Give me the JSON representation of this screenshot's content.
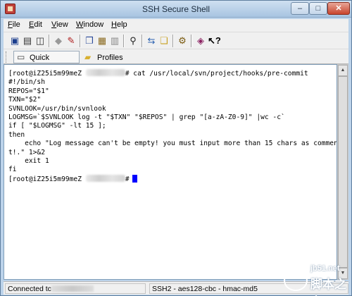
{
  "window": {
    "title": "SSH Secure Shell"
  },
  "title_buttons": {
    "minimize": "–",
    "maximize": "□",
    "close": "✕"
  },
  "menu": [
    {
      "label": "File",
      "u": "F",
      "rest": "ile"
    },
    {
      "label": "Edit",
      "u": "E",
      "rest": "dit"
    },
    {
      "label": "View",
      "u": "V",
      "rest": "iew"
    },
    {
      "label": "Window",
      "u": "W",
      "rest": "indow"
    },
    {
      "label": "Help",
      "u": "H",
      "rest": "elp"
    }
  ],
  "toolbar_icons": [
    "save-icon",
    "print-icon",
    "print-preview-icon",
    "disconnect-icon",
    "connect-icon",
    "copy-icon",
    "paste-icon",
    "paste-selection-icon",
    "find-icon",
    "file-transfer-icon",
    "new-window-icon",
    "settings-icon",
    "help-topics-icon",
    "context-help-icon"
  ],
  "profile_bar": {
    "quick_connect": "Quick Connect",
    "profiles": "Profiles"
  },
  "terminal": {
    "prompt_user": "[root@iZ25i5m99meZ",
    "line1_cmd": "# cat /usr/local/svn/project/hooks/pre-commit",
    "lines": [
      "#!/bin/sh",
      "",
      "REPOS=\"$1\"",
      "",
      "TXN=\"$2\"",
      "",
      "SVNLOOK=/usr/bin/svnlook",
      "",
      "LOGMSG=`$SVNLOOK log -t \"$TXN\" \"$REPOS\" | grep \"[a-zA-Z0-9]\" |wc -c`",
      "",
      "",
      "",
      "if [ \"$LOGMSG\" -lt 15 ];",
      "",
      "then",
      "",
      "    echo \"Log message can't be empty! you must input more than 15 chars as commen",
      "t!.\" 1>&2",
      "",
      "    exit 1",
      "",
      "fi"
    ],
    "last_prompt_end": "#"
  },
  "status": {
    "connected_prefix": "Connected tc",
    "encryption": "SSH2 - aes128-cbc - hmac-md5"
  },
  "watermark": {
    "url": "jb51.net",
    "name": "脚本之家"
  }
}
